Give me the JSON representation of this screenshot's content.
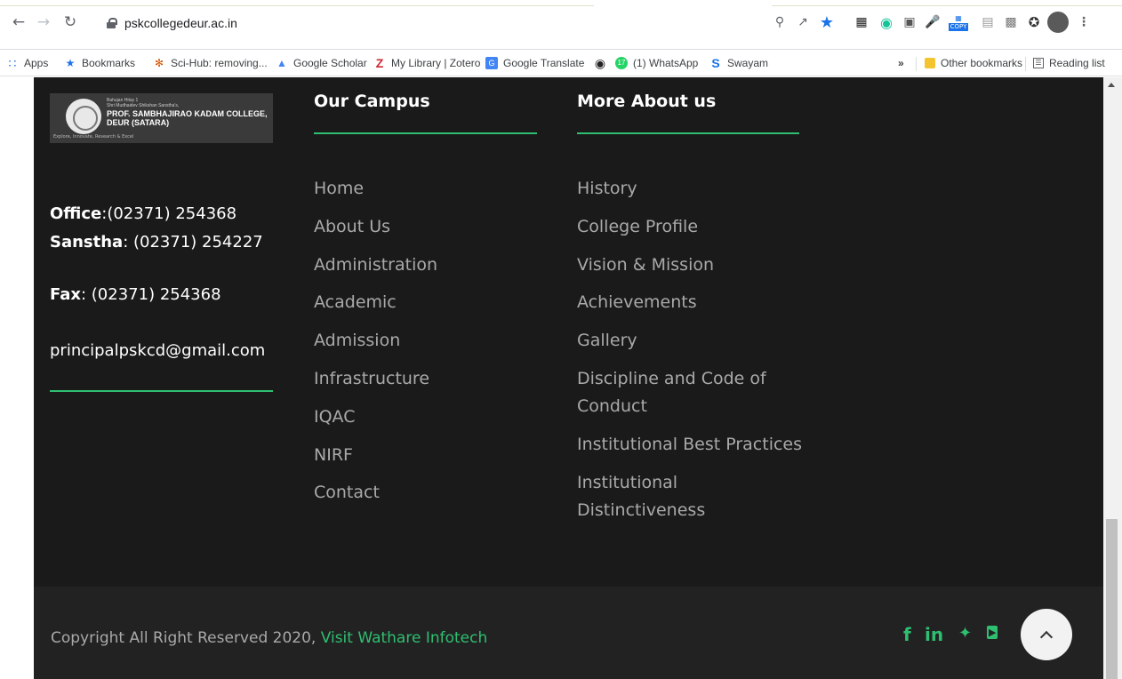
{
  "browser": {
    "url": "pskcollegedeur.ac.in",
    "bookmarks": [
      {
        "label": "Apps",
        "icon": "apps-grid-icon"
      },
      {
        "label": "Bookmarks",
        "icon": "star-icon"
      },
      {
        "label": "Sci-Hub: removing...",
        "icon": "scihub-icon"
      },
      {
        "label": "Google Scholar",
        "icon": "scholar-icon"
      },
      {
        "label": "My Library | Zotero",
        "icon": "zotero-icon"
      },
      {
        "label": "Google Translate",
        "icon": "translate-icon"
      },
      {
        "label": "",
        "icon": "github-icon"
      },
      {
        "label": "(1) WhatsApp",
        "icon": "whatsapp-icon"
      },
      {
        "label": "Swayam",
        "icon": "swayam-icon"
      }
    ],
    "overflow": "»",
    "other_bookmarks": "Other bookmarks",
    "reading_list": "Reading list",
    "whatsapp_badge": "17",
    "copy_badge": "COPY"
  },
  "logo": {
    "small1": "Bahujan Hitay 1",
    "small2": "Shri Mudhaidev Shikshan Sanstha's,",
    "name1": "PROF. SAMBHAJIRAO KADAM COLLEGE,",
    "name2": "DEUR (SATARA)",
    "tagline": "Explore, Innovate, Research & Excel"
  },
  "contact": {
    "office_label": "Office",
    "office_value": ":(02371) 254368",
    "sanstha_label": "Sanstha",
    "sanstha_value": ": (02371) 254227",
    "fax_label": "Fax",
    "fax_value": ":  (02371) 254368",
    "email": "principalpskcd@gmail.com"
  },
  "campus": {
    "title": "Our Campus",
    "links": [
      "Home",
      "About Us",
      "Administration",
      "Academic",
      "Admission",
      "Infrastructure",
      "IQAC",
      "NIRF",
      "Contact"
    ]
  },
  "about": {
    "title": "More About us",
    "links": [
      "History",
      "College Profile",
      "Vision & Mission",
      "Achievements",
      "Gallery",
      "Discipline and Code of Conduct",
      "Institutional Best Practices",
      "Institutional Distinctiveness"
    ]
  },
  "footer": {
    "copyright": "Copyright All Right Reserved 2020, ",
    "link": "Visit Wathare Infotech",
    "social": [
      "facebook-icon",
      "linkedin-icon",
      "twitter-icon",
      "youtube-icon"
    ]
  },
  "colors": {
    "accent": "#2fbf71",
    "page_bg": "#1a1a1a",
    "footer_bg": "#222222"
  }
}
